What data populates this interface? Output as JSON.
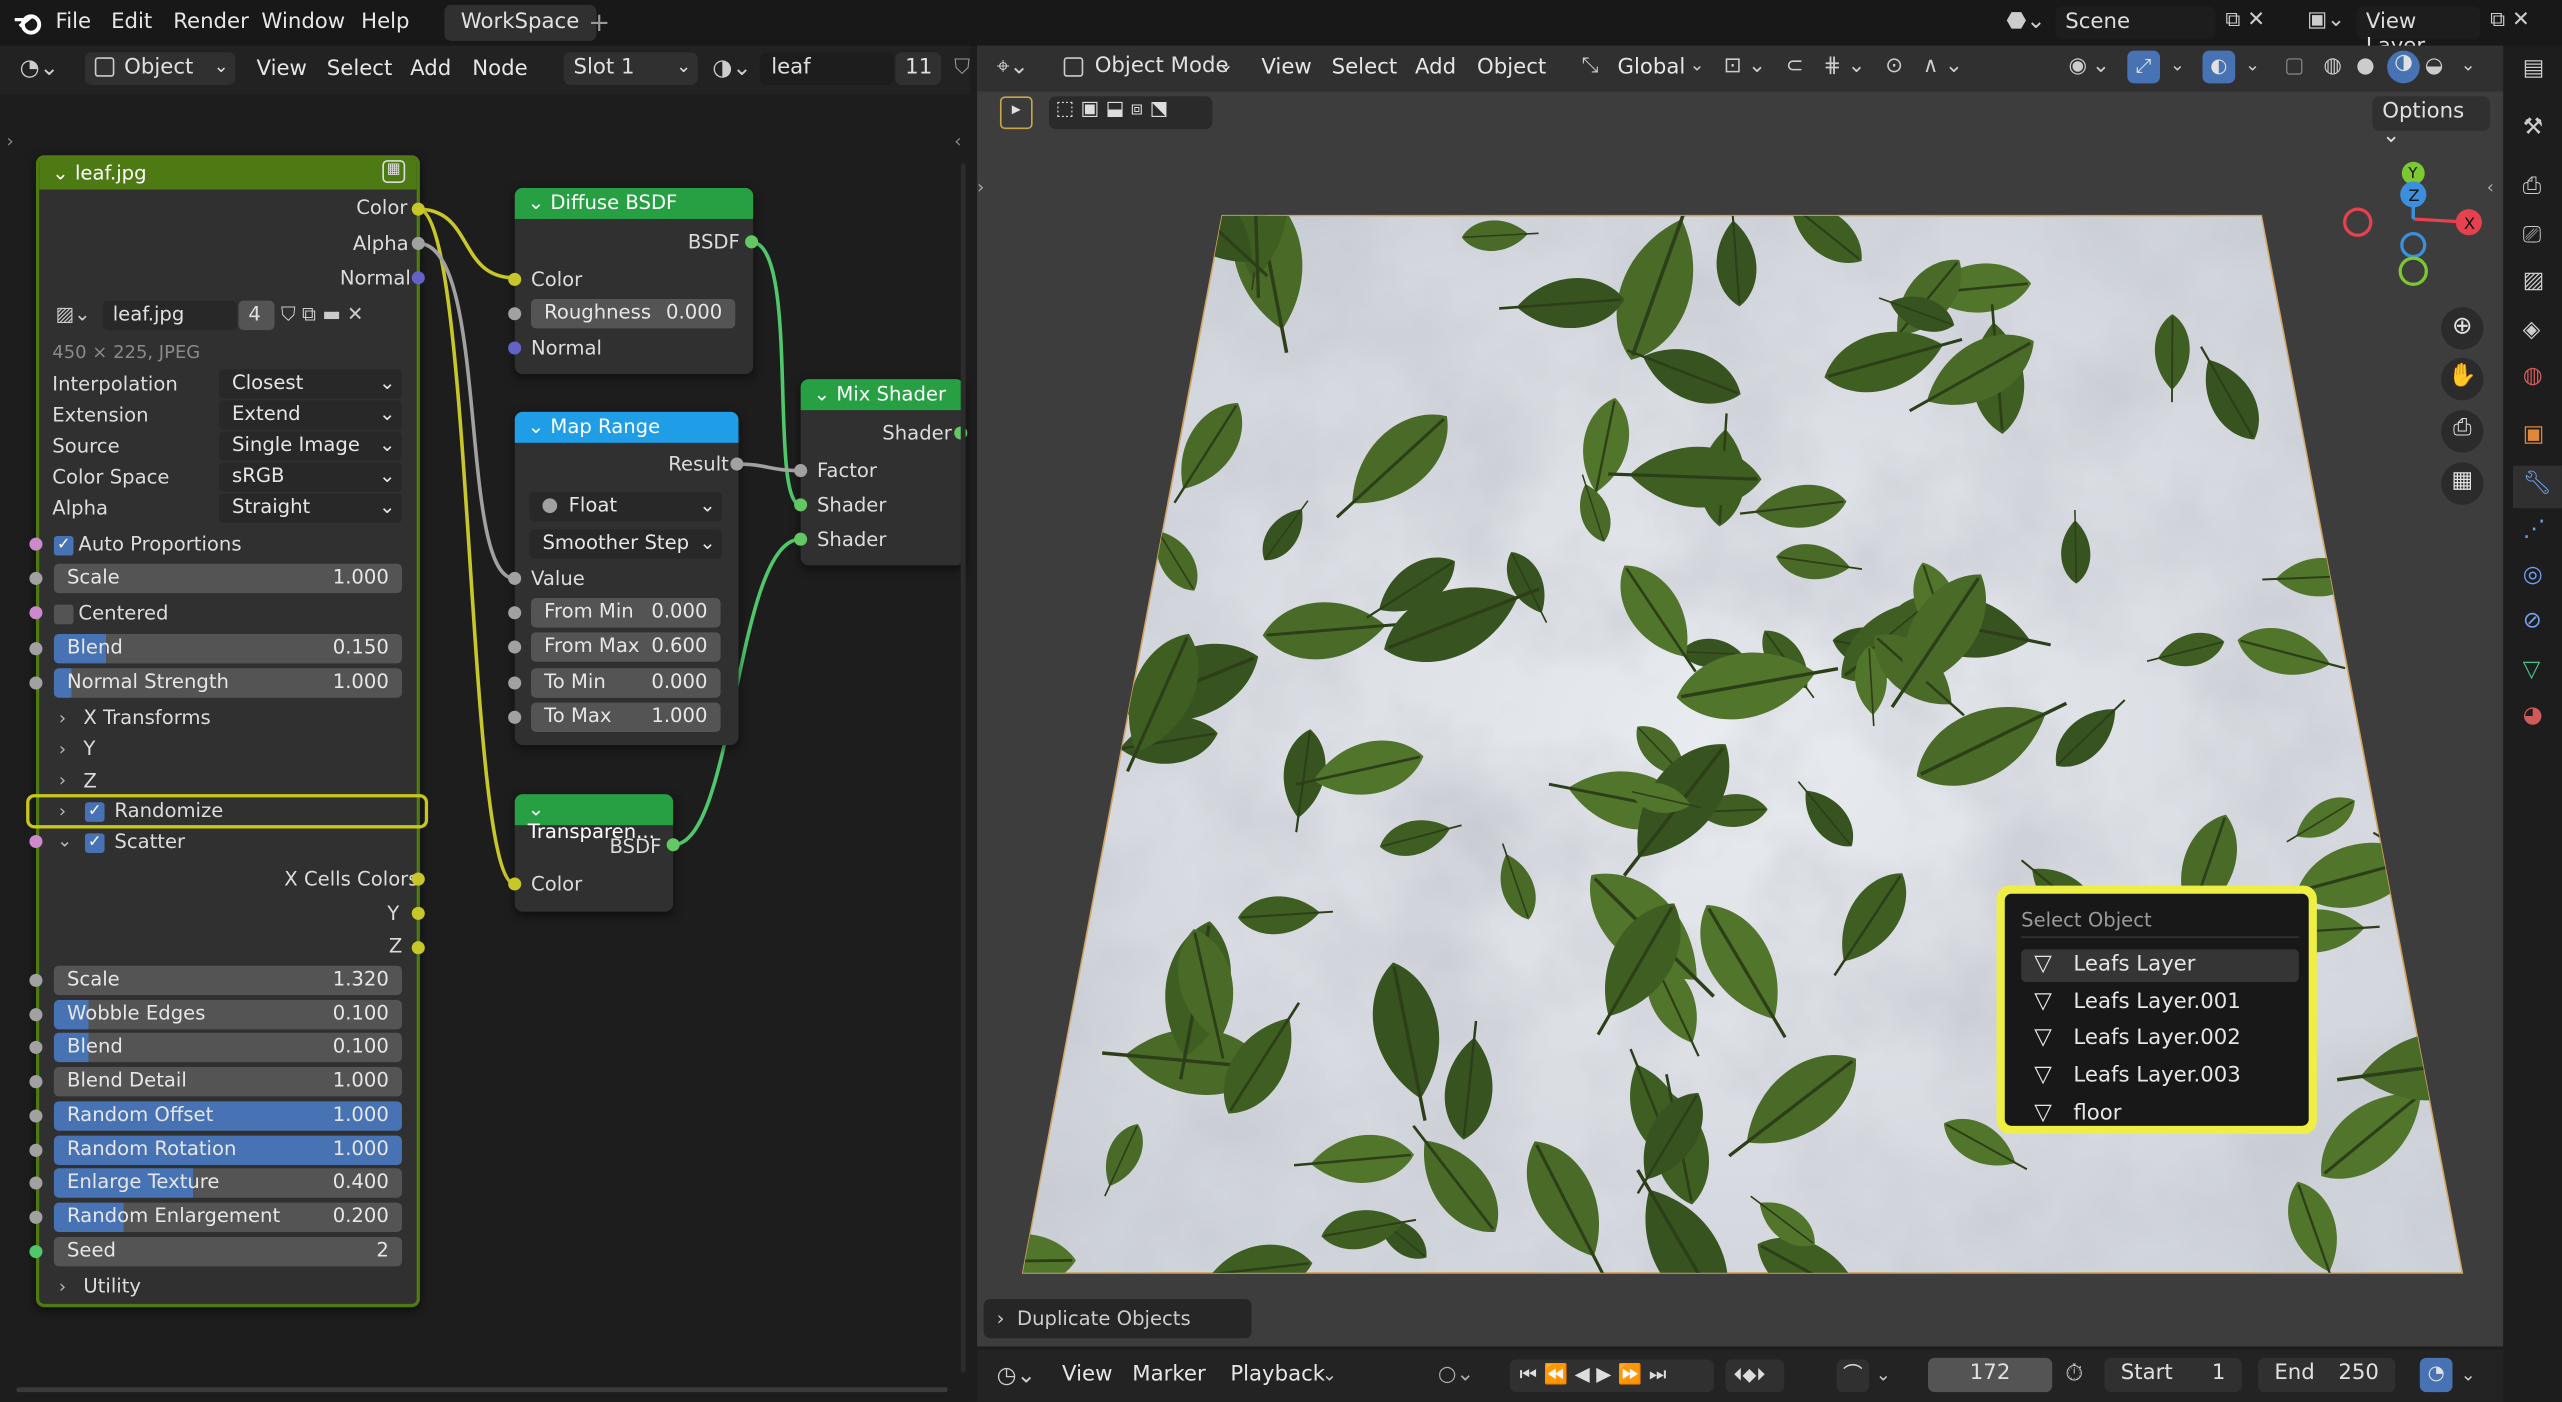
{
  "topbar": {
    "menus": [
      "File",
      "Edit",
      "Render",
      "Window",
      "Help"
    ],
    "workspace_tab": "WorkSpace",
    "add_tab": "+",
    "scene": "Scene",
    "view_layer": "View Layer"
  },
  "node_header": {
    "object": "Object",
    "menus": [
      "View",
      "Select",
      "Add",
      "Node"
    ],
    "slot": "Slot 1",
    "material": "leaf",
    "users": "11"
  },
  "image_node": {
    "title": "leaf.jpg",
    "outputs": [
      "Color",
      "Alpha",
      "Normal"
    ],
    "image_name": "leaf.jpg",
    "users": "4",
    "info": "450 × 225, JPEG",
    "props": [
      {
        "label": "Interpolation",
        "value": "Closest"
      },
      {
        "label": "Extension",
        "value": "Extend"
      },
      {
        "label": "Source",
        "value": "Single Image"
      },
      {
        "label": "Color Space",
        "value": "sRGB"
      },
      {
        "label": "Alpha",
        "value": "Straight"
      }
    ],
    "auto_proportions": "Auto Proportions",
    "scale": {
      "label": "Scale",
      "value": "1.000"
    },
    "centered": "Centered",
    "blend": {
      "label": "Blend",
      "value": "0.150"
    },
    "normal_strength": {
      "label": "Normal Strength",
      "value": "1.000"
    },
    "x_transforms": "X Transforms",
    "y": "Y",
    "z": "Z",
    "randomize": "Randomize",
    "scatter": "Scatter",
    "cells_out": [
      "X Cells Colors",
      "Y",
      "Z"
    ],
    "scatter_props": [
      {
        "label": "Scale",
        "value": "1.320",
        "fill": 0
      },
      {
        "label": "Wobble Edges",
        "value": "0.100",
        "fill": 0.1
      },
      {
        "label": "Blend",
        "value": "0.100",
        "fill": 0.1
      },
      {
        "label": "Blend Detail",
        "value": "1.000",
        "fill": 0
      },
      {
        "label": "Random Offset",
        "value": "1.000",
        "fill": 1
      },
      {
        "label": "Random Rotation",
        "value": "1.000",
        "fill": 1
      },
      {
        "label": "Enlarge Texture",
        "value": "0.400",
        "fill": 0.4
      },
      {
        "label": "Random Enlargement",
        "value": "0.200",
        "fill": 0.2
      },
      {
        "label": "Seed",
        "value": "2",
        "fill": 0
      }
    ],
    "utility": "Utility"
  },
  "diffuse_node": {
    "title": "Diffuse BSDF",
    "output": "BSDF",
    "color": "Color",
    "roughness": {
      "label": "Roughness",
      "value": "0.000"
    },
    "normal": "Normal"
  },
  "maprange_node": {
    "title": "Map Range",
    "output": "Result",
    "type": "Float",
    "interp": "Smoother Step",
    "value": "Value",
    "fields": [
      {
        "label": "From Min",
        "value": "0.000"
      },
      {
        "label": "From Max",
        "value": "0.600"
      },
      {
        "label": "To Min",
        "value": "0.000"
      },
      {
        "label": "To Max",
        "value": "1.000"
      }
    ]
  },
  "transparent_node": {
    "title": "Transparen...",
    "output": "BSDF",
    "color": "Color"
  },
  "mix_node": {
    "title": "Mix Shader",
    "output": "Shader",
    "inputs": [
      "Factor",
      "Shader",
      "Shader"
    ]
  },
  "viewport_header": {
    "mode": "Object Mode",
    "menus": [
      "View",
      "Select",
      "Add",
      "Object"
    ],
    "orientation": "Global",
    "options": "Options"
  },
  "gizmo": {
    "x": "X",
    "y": "Y",
    "z": "Z"
  },
  "popup": {
    "title": "Select Object",
    "items": [
      "Leafs Layer",
      "Leafs Layer.001",
      "Leafs Layer.002",
      "Leafs Layer.003",
      "floor"
    ]
  },
  "operator_panel": "Duplicate Objects",
  "timeline": {
    "menus": [
      "View",
      "Marker",
      "Playback"
    ],
    "current_frame": "172",
    "start_label": "Start",
    "start": "1",
    "end_label": "End",
    "end": "250"
  },
  "colors": {
    "highlight": "#eeee44",
    "node_green": "#27a044",
    "node_blue": "#1f9de6",
    "texture_header": "#4d7a13"
  }
}
